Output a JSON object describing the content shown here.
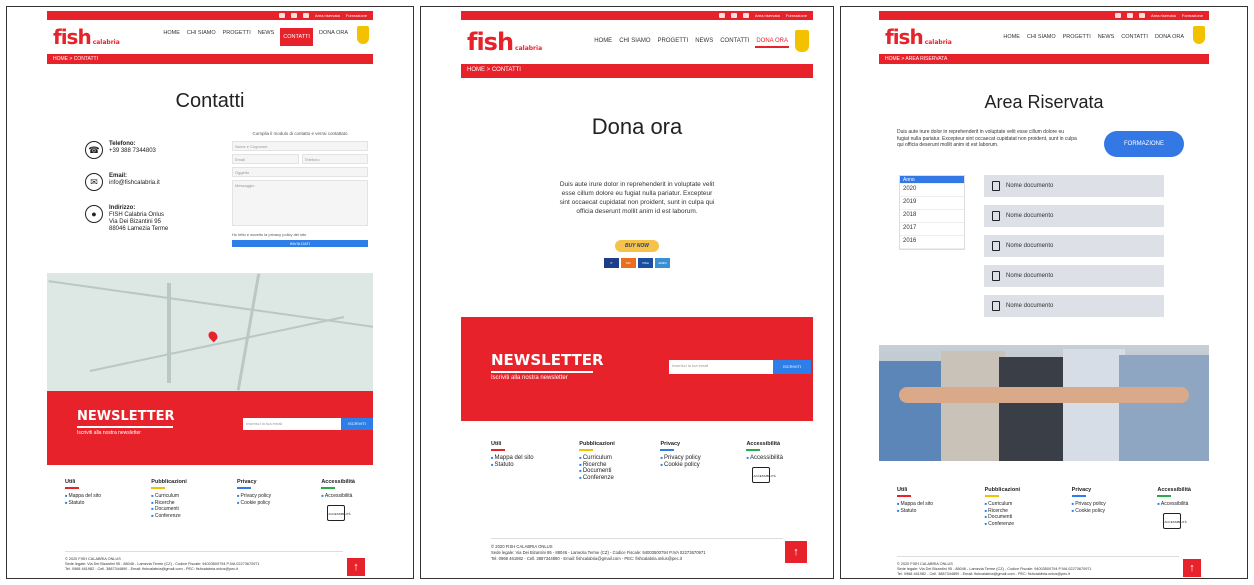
{
  "header": {
    "logo_main": "fish",
    "logo_sub": "calabria",
    "top_links": [
      "Area riservata",
      "Formazione"
    ],
    "nav": [
      "HOME",
      "CHI SIAMO",
      "PROGETTI",
      "NEWS",
      "CONTATTI",
      "DONA ORA"
    ]
  },
  "contatti": {
    "crumb": "HOME > CONTATTI",
    "title": "Contatti",
    "phone_label": "Telefono:",
    "phone_value": "+39 388 7344803",
    "email_label": "Email:",
    "email_value": "info@fishcalabria.it",
    "addr_label": "Indirizzo:",
    "addr_lines": [
      "FISH Calabria Onlus",
      "Via Dei Bizantini 95",
      "88046 Lamezia Terme"
    ],
    "form_hint": "Compila il modulo di contatto e verrai contattato",
    "name_ph": "Nome e Cognome",
    "email_ph": "Email",
    "tel_ph": "Telefono",
    "subject_ph": "Oggetto",
    "message_ph": "Messaggio",
    "privacy": "Ho letto e accetto la privacy policy del sito",
    "send": "INVIA DATI"
  },
  "dona": {
    "crumb": "HOME > CONTATTI",
    "title": "Dona ora",
    "text": "Duis aute irure dolor in reprehenderit in voluptate velit esse cillum dolore eu fugiat nulla pariatur. Excepteur sint occaecat cupidatat non proident, sunt in culpa qui officia deserunt mollit anim id est laborum.",
    "buy": "BUY NOW",
    "cards": [
      "P",
      "MC",
      "VISA",
      "AMEX"
    ]
  },
  "area": {
    "crumb": "HOME > AREA RISERVATA",
    "title": "Area Riservata",
    "intro": "Duis aute irure dolor in reprehenderit in voluptate velit esse cillum dolore eu fugiat nulla pariatur. Excepteur sint occaecat cupidatat non proident, sunt in culpa qui officia deserunt mollit anim id est laborum.",
    "button": "FORMAZIONE",
    "years_header": "Anno",
    "years": [
      "2020",
      "2019",
      "2018",
      "2017",
      "2016"
    ],
    "doc_label": "Nome documento"
  },
  "newsletter": {
    "title": "NEWSLETTER",
    "subtitle": "Iscriviti alla nostra newsletter",
    "input_ph": "Inserisci la tua email",
    "button": "ISCRIVITI"
  },
  "footer": {
    "cols": [
      {
        "title": "Utili",
        "items": [
          "Mappa del sito",
          "Statuto"
        ]
      },
      {
        "title": "Pubblicazioni",
        "items": [
          "Curriculum",
          "Ricerche",
          "Documenti",
          "Conferenze"
        ]
      },
      {
        "title": "Privacy",
        "items": [
          "Privacy policy",
          "Cookie policy"
        ]
      },
      {
        "title": "Accessibilità",
        "items": [
          "Accessibilità"
        ]
      }
    ],
    "copyright": "© 2020 FISH CALABRIA ONLUS",
    "address": "Sede legale: Via Dei Bizantini 95 - 88046 - Lamezia Terme (CZ) - Codice Fiscale: 94003500794 P.IVA 02273670971",
    "contacts": "Tel. 0968 461982 - Cell. 3887344890 - Email: fishcalabria@gmail.com - PEC: fishcalabria.onlus@pec.it",
    "accessibility_badge": "ACCESSIBILITÀ"
  },
  "colors": {
    "brand": "#e8222a",
    "accent": "#2d7ee8"
  }
}
